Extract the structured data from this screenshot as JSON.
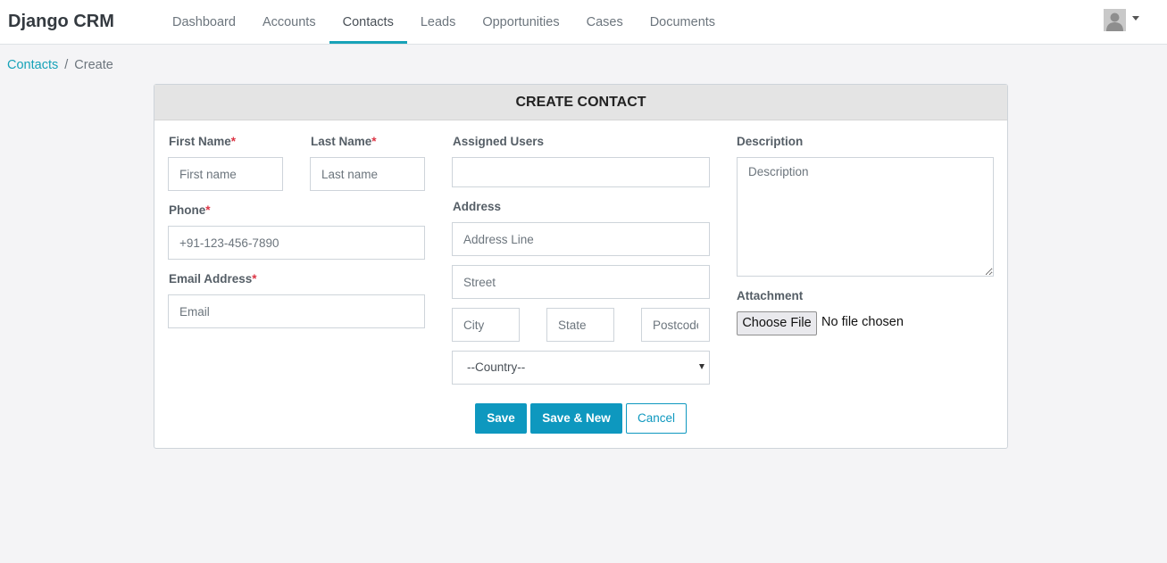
{
  "app": {
    "brand": "Django CRM"
  },
  "nav": {
    "items": [
      {
        "label": "Dashboard",
        "active": false
      },
      {
        "label": "Accounts",
        "active": false
      },
      {
        "label": "Contacts",
        "active": true
      },
      {
        "label": "Leads",
        "active": false
      },
      {
        "label": "Opportunities",
        "active": false
      },
      {
        "label": "Cases",
        "active": false
      },
      {
        "label": "Documents",
        "active": false
      }
    ]
  },
  "user": {
    "avatar_icon": "user-avatar-icon",
    "menu_icon": "caret-down-icon"
  },
  "breadcrumb": {
    "parent": "Contacts",
    "separator": "/",
    "current": "Create"
  },
  "form": {
    "title": "CREATE CONTACT",
    "required_marker": "*",
    "first_name": {
      "label": "First Name",
      "placeholder": "First name",
      "value": ""
    },
    "last_name": {
      "label": "Last Name",
      "placeholder": "Last name",
      "value": ""
    },
    "phone": {
      "label": "Phone",
      "placeholder": "+91-123-456-7890",
      "value": ""
    },
    "email": {
      "label": "Email Address",
      "placeholder": "Email",
      "value": ""
    },
    "assigned_users": {
      "label": "Assigned Users",
      "value": ""
    },
    "address": {
      "label": "Address",
      "line_placeholder": "Address Line",
      "street_placeholder": "Street",
      "city_placeholder": "City",
      "state_placeholder": "State",
      "postcode_placeholder": "Postcode",
      "country_selected": "--Country--"
    },
    "description": {
      "label": "Description",
      "placeholder": "Description",
      "value": ""
    },
    "attachment": {
      "label": "Attachment",
      "button": "Choose File",
      "status": "No file chosen"
    },
    "buttons": {
      "save": "Save",
      "save_new": "Save & New",
      "cancel": "Cancel"
    }
  },
  "colors": {
    "accent": "#17a2b8",
    "primary_button": "#0e98bf",
    "required": "#dc3545"
  }
}
